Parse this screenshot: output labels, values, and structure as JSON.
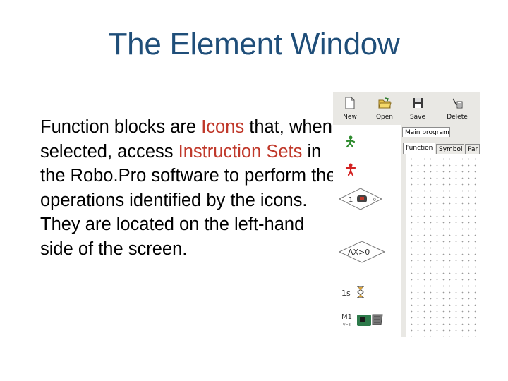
{
  "slide": {
    "title": "The Element Window",
    "body": [
      {
        "text": "Function blocks are ",
        "highlight": false
      },
      {
        "text": "Icons",
        "highlight": true
      },
      {
        "text": " that, when selected, access ",
        "highlight": false
      },
      {
        "text": "Instruction Sets",
        "highlight": true
      },
      {
        "text": " in the Robo.Pro software to perform the operations identified by the icons. They are located on the left-hand side of the screen.",
        "highlight": false
      }
    ],
    "highlight_color": "#c0392b",
    "title_color": "#1f4e79"
  },
  "screenshot": {
    "toolbar": [
      {
        "label": "New",
        "icon": "new-file-icon"
      },
      {
        "label": "Open",
        "icon": "open-folder-icon"
      },
      {
        "label": "Save",
        "icon": "save-disk-icon"
      },
      {
        "label": "Delete",
        "icon": "delete-icon"
      }
    ],
    "main_tab": "Main program",
    "sub_tabs": [
      "Function",
      "Symbol",
      "Par"
    ],
    "blocks": [
      {
        "name": "start-block",
        "icon": "green-running-man-icon"
      },
      {
        "name": "end-block",
        "icon": "red-stop-man-icon"
      },
      {
        "name": "branch-block",
        "label": "1",
        "icon": "sensor-diamond-icon"
      },
      {
        "name": "compare-block",
        "label": "AX>0"
      },
      {
        "name": "wait-block",
        "label": "1s",
        "icon": "hourglass-icon"
      },
      {
        "name": "motor-block",
        "label": "M1",
        "icon": "motor-icon"
      }
    ]
  }
}
